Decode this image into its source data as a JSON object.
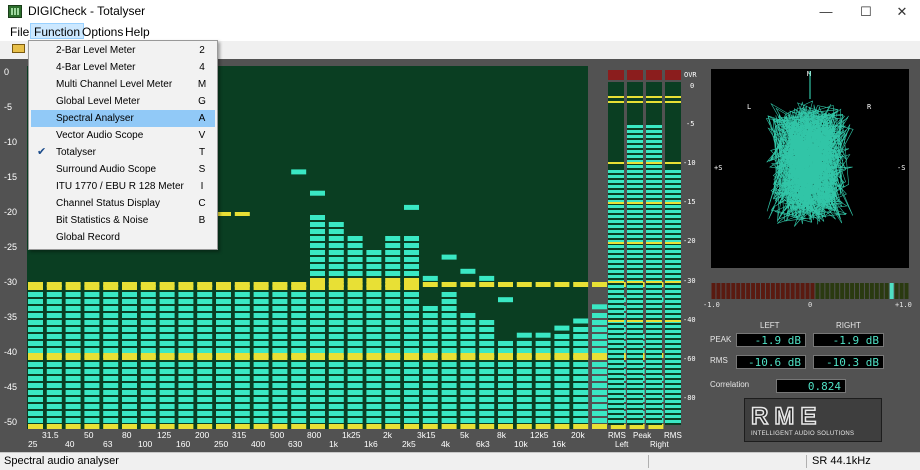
{
  "window": {
    "title": "DIGICheck - Totalyser",
    "minimize": "—",
    "maximize": "☐",
    "close": "✕"
  },
  "menubar": [
    "File",
    "Function",
    "Options",
    "Help"
  ],
  "function_menu": [
    {
      "label": "2-Bar Level Meter",
      "key": "2"
    },
    {
      "label": "4-Bar Level Meter",
      "key": "4"
    },
    {
      "label": "Multi Channel Level Meter",
      "key": "M"
    },
    {
      "label": "Global Level Meter",
      "key": "G"
    },
    {
      "label": "Spectral Analyser",
      "key": "A",
      "highlighted": true
    },
    {
      "label": "Vector Audio Scope",
      "key": "V"
    },
    {
      "label": "Totalyser",
      "key": "T",
      "checked": true
    },
    {
      "label": "Surround Audio Scope",
      "key": "S"
    },
    {
      "label": "ITU 1770 / EBU R 128 Meter",
      "key": "I"
    },
    {
      "label": "Channel Status Display",
      "key": "C"
    },
    {
      "label": "Bit Statistics & Noise",
      "key": "B"
    },
    {
      "label": "Global Record",
      "key": ""
    }
  ],
  "spectrum": {
    "y_labels": [
      "0",
      "-5",
      "-10",
      "-15",
      "-20",
      "-25",
      "-30",
      "-35",
      "-40",
      "-45",
      "-50"
    ],
    "x_labels_top": [
      "31.5",
      "50",
      "80",
      "125",
      "200",
      "315",
      "500",
      "800",
      "1k25",
      "2k",
      "3k15",
      "5k",
      "8k",
      "12k5",
      "20k"
    ],
    "x_labels_bottom": [
      "25",
      "40",
      "63",
      "100",
      "160",
      "250",
      "400",
      "630",
      "1k",
      "1k6",
      "2k5",
      "4k",
      "6k3",
      "10k",
      "16k"
    ],
    "bands_db": [
      -30,
      -30,
      -30,
      -30,
      -30,
      -30,
      -30,
      -30,
      -30,
      -30,
      -30,
      -30,
      -30,
      -30,
      -30,
      -20,
      -21,
      -23,
      -25,
      -23,
      -23,
      -33,
      -31,
      -34,
      -35,
      -38,
      -38,
      -38,
      -37,
      -36,
      -34,
      -33,
      -37,
      -43
    ],
    "peaks_db": [
      -30,
      -30,
      -30,
      -30,
      -30,
      -30,
      -30,
      -30,
      -30,
      -30,
      -30,
      -30,
      -30,
      -30,
      -14,
      -17,
      -23,
      -23,
      -25,
      -23,
      -19,
      -29,
      -26,
      -28,
      -29,
      -32,
      -37,
      -37,
      -36,
      -35,
      -33,
      -32,
      -37,
      -32
    ]
  },
  "level_meter": {
    "scale": [
      "OVR",
      "0",
      "-5",
      "-10",
      "-15",
      "-20",
      "-30",
      "-40",
      "-60",
      "-80"
    ],
    "bottom_top": [
      "RMS",
      "Peak",
      "RMS"
    ],
    "bottom_bot": [
      "Left",
      "Right"
    ],
    "bars_norm": [
      0.75,
      0.88,
      0.88,
      0.75
    ]
  },
  "scope": {
    "top_label": "M",
    "left_label": "L",
    "right_label": "R",
    "side_left": "+S",
    "side_right": "-S"
  },
  "correlation_scale": {
    "left": "-1.0",
    "mid": "0",
    "right": "+1.0"
  },
  "readouts": {
    "left_header": "LEFT",
    "right_header": "RIGHT",
    "peak_label": "PEAK",
    "rms_label": "RMS",
    "peak_left": "-1.9 dB",
    "peak_right": "-1.9 dB",
    "rms_left": "-10.6 dB",
    "rms_right": "-10.3 dB",
    "correlation_label": "Correlation",
    "correlation_value": "0.824"
  },
  "logo": {
    "text": "RME",
    "tagline": "INTELLIGENT AUDIO SOLUTIONS"
  },
  "status": {
    "left": "Spectral audio analyser",
    "right": "SR 44.1kHz"
  },
  "colors": {
    "bar": "#3ae8c4",
    "peak_line": "#e8e035",
    "background": "#525252",
    "dark_segment": "#0a3e22"
  }
}
